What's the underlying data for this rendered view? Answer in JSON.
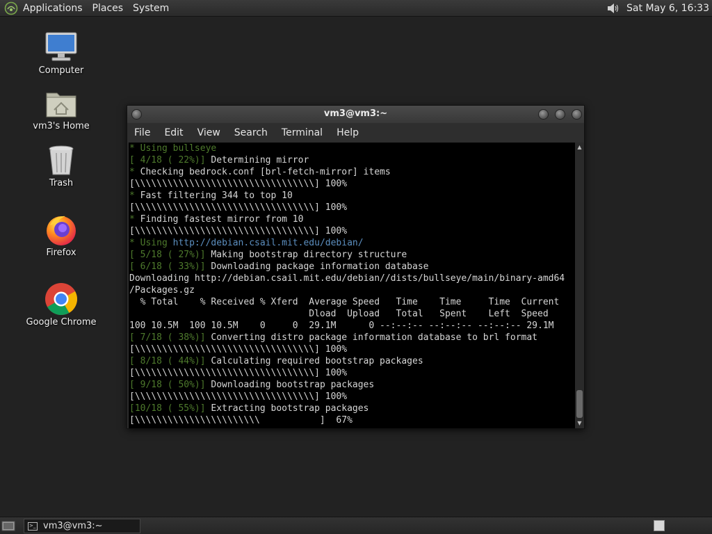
{
  "top_panel": {
    "menus": [
      "Applications",
      "Places",
      "System"
    ],
    "clock": "Sat May  6, 16:33"
  },
  "desktop_icons": [
    {
      "label": "Computer",
      "icon": "computer-icon"
    },
    {
      "label": "vm3's Home",
      "icon": "home-folder-icon"
    },
    {
      "label": "Trash",
      "icon": "trash-icon"
    },
    {
      "label": "Firefox",
      "icon": "firefox-icon"
    },
    {
      "label": "Google Chrome",
      "icon": "chrome-icon"
    }
  ],
  "terminal": {
    "title": "vm3@vm3:~",
    "menu": [
      "File",
      "Edit",
      "View",
      "Search",
      "Terminal",
      "Help"
    ],
    "lines": [
      [
        {
          "t": "* Using ",
          "c": "g"
        },
        {
          "t": "bullseye",
          "c": "g"
        }
      ],
      [
        {
          "t": "[ 4/18 ( 22%)] ",
          "c": "g"
        },
        {
          "t": "Determining mirror"
        }
      ],
      [
        {
          "t": "* ",
          "c": "g"
        },
        {
          "t": "Checking bedrock.conf [brl-fetch-mirror] items"
        }
      ],
      [
        {
          "t": "[\\\\\\\\\\\\\\\\\\\\\\\\\\\\\\\\\\\\\\\\\\\\\\\\\\\\\\\\\\\\\\\\\\] 100%"
        }
      ],
      [
        {
          "t": "* ",
          "c": "g"
        },
        {
          "t": "Fast filtering 344 to top 10"
        }
      ],
      [
        {
          "t": "[\\\\\\\\\\\\\\\\\\\\\\\\\\\\\\\\\\\\\\\\\\\\\\\\\\\\\\\\\\\\\\\\\\] 100%"
        }
      ],
      [
        {
          "t": "* ",
          "c": "g"
        },
        {
          "t": "Finding fastest mirror from 10"
        }
      ],
      [
        {
          "t": "[\\\\\\\\\\\\\\\\\\\\\\\\\\\\\\\\\\\\\\\\\\\\\\\\\\\\\\\\\\\\\\\\\\] 100%"
        }
      ],
      [
        {
          "t": "* Using ",
          "c": "g"
        },
        {
          "t": "http://debian.csail.mit.edu/debian/",
          "c": "u"
        }
      ],
      [
        {
          "t": "[ 5/18 ( 27%)] ",
          "c": "g"
        },
        {
          "t": "Making bootstrap directory structure"
        }
      ],
      [
        {
          "t": "[ 6/18 ( 33%)] ",
          "c": "g"
        },
        {
          "t": "Downloading package information database"
        }
      ],
      [
        {
          "t": "Downloading http://debian.csail.mit.edu/debian//dists/bullseye/main/binary-amd64"
        }
      ],
      [
        {
          "t": "/Packages.gz"
        }
      ],
      [
        {
          "t": "  % Total    % Received % Xferd  Average Speed   Time    Time     Time  Current"
        }
      ],
      [
        {
          "t": "                                 Dload  Upload   Total   Spent    Left  Speed"
        }
      ],
      [
        {
          "t": "100 10.5M  100 10.5M    0     0  29.1M      0 --:--:-- --:--:-- --:--:-- 29.1M"
        }
      ],
      [
        {
          "t": "[ 7/18 ( 38%)] ",
          "c": "g"
        },
        {
          "t": "Converting distro package information database to brl format"
        }
      ],
      [
        {
          "t": "[\\\\\\\\\\\\\\\\\\\\\\\\\\\\\\\\\\\\\\\\\\\\\\\\\\\\\\\\\\\\\\\\\\] 100%"
        }
      ],
      [
        {
          "t": "[ 8/18 ( 44%)] ",
          "c": "g"
        },
        {
          "t": "Calculating required bootstrap packages"
        }
      ],
      [
        {
          "t": "[\\\\\\\\\\\\\\\\\\\\\\\\\\\\\\\\\\\\\\\\\\\\\\\\\\\\\\\\\\\\\\\\\\] 100%"
        }
      ],
      [
        {
          "t": "[ 9/18 ( 50%)] ",
          "c": "g"
        },
        {
          "t": "Downloading bootstrap packages"
        }
      ],
      [
        {
          "t": "[\\\\\\\\\\\\\\\\\\\\\\\\\\\\\\\\\\\\\\\\\\\\\\\\\\\\\\\\\\\\\\\\\\] 100%"
        }
      ],
      [
        {
          "t": "[10/18 ( 55%)] ",
          "c": "g"
        },
        {
          "t": "Extracting bootstrap packages"
        }
      ],
      [
        {
          "t": "[\\\\\\\\\\\\\\\\\\\\\\\\\\\\\\\\\\\\\\\\\\\\\\           ]  67%"
        }
      ]
    ]
  },
  "taskbar": {
    "task_label": "vm3@vm3:~"
  }
}
